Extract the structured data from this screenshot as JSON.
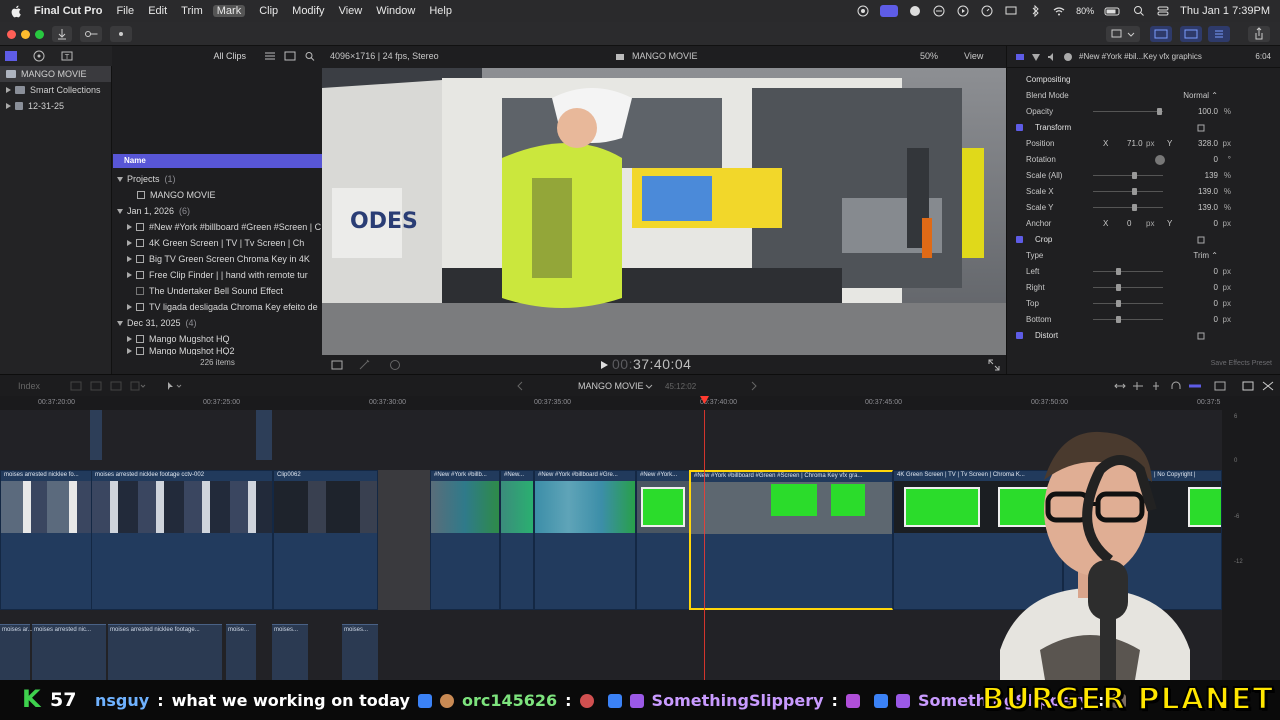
{
  "menubar": {
    "app_name": "Final Cut Pro",
    "menus": [
      "File",
      "Edit",
      "Trim",
      "Mark",
      "Clip",
      "Modify",
      "View",
      "Window",
      "Help"
    ],
    "active_menu": "Mark",
    "battery": "80%",
    "datetime": "Thu Jan 1  7:39PM"
  },
  "browser": {
    "filter_label": "All Clips",
    "libraries": [
      {
        "label": "MANGO MOVIE",
        "selected": true
      },
      {
        "label": "Smart Collections"
      },
      {
        "label": "12-31-25"
      }
    ],
    "column_header": "Name",
    "groups": [
      {
        "label": "Projects",
        "count": "(1)",
        "items": [
          "MANGO MOVIE"
        ]
      },
      {
        "label": "Jan 1, 2026",
        "count": "(6)",
        "items": [
          "#New #York #billboard #Green #Screen | C",
          "4K Green Screen  |  TV  |  Tv Screen  |  Ch",
          "Big TV Green Screen Chroma Key in 4K",
          "Free Clip  Finder  |  |  hand with remote tur",
          "The Undertaker Bell   Sound Effect",
          "TV ligada desligada Chroma Key efeito de"
        ]
      },
      {
        "label": "Dec 31, 2025",
        "count": "(4)",
        "items": [
          "Mango Mugshot HQ",
          "Mango Mugshot HQ2"
        ]
      }
    ],
    "items_count": "226 items"
  },
  "viewer": {
    "format": "4096×1716 | 24 fps, Stereo",
    "project_title": "MANGO MOVIE",
    "zoom": "50%",
    "view_label": "View",
    "timecode_dim": "00:",
    "timecode": "37:40:04"
  },
  "inspector": {
    "clip_title": "#New #York #bil...Key vfx graphics",
    "duration": "6:04",
    "rows": [
      {
        "label": "Compositing",
        "type": "header"
      },
      {
        "label": "Blend Mode",
        "value": "Normal ⌃"
      },
      {
        "label": "Opacity",
        "value": "100.0",
        "unit": "%",
        "slider": 0.98
      },
      {
        "label": "Transform",
        "type": "section"
      },
      {
        "label": "Position",
        "x_label": "X",
        "x": "71.0",
        "x_unit": "px",
        "y_label": "Y",
        "y": "328.0",
        "unit": "px"
      },
      {
        "label": "Rotation",
        "value": "0",
        "unit": "°",
        "dial": true
      },
      {
        "label": "Scale (All)",
        "value": "139",
        "unit": "%",
        "slider": 0.6
      },
      {
        "label": "Scale X",
        "value": "139.0",
        "unit": "%",
        "slider": 0.6
      },
      {
        "label": "Scale Y",
        "value": "139.0",
        "unit": "%",
        "slider": 0.6
      },
      {
        "label": "Anchor",
        "x_label": "X",
        "x": "0",
        "x_unit": "px",
        "y_label": "Y",
        "y": "0",
        "unit": "px"
      },
      {
        "label": "Crop",
        "type": "section"
      },
      {
        "label": "Type",
        "value": "Trim ⌃"
      },
      {
        "label": "Left",
        "value": "0",
        "unit": "px",
        "slider": 0.35
      },
      {
        "label": "Right",
        "value": "0",
        "unit": "px",
        "slider": 0.35
      },
      {
        "label": "Top",
        "value": "0",
        "unit": "px",
        "slider": 0.35
      },
      {
        "label": "Bottom",
        "value": "0",
        "unit": "px",
        "slider": 0.35
      },
      {
        "label": "Distort",
        "type": "section"
      }
    ],
    "save_preset": "Save Effects Preset"
  },
  "timeline": {
    "index_label": "Index",
    "project_title": "MANGO MOVIE",
    "project_duration": "45:12:02",
    "ruler": [
      "00:37:20:00",
      "00:37:25:00",
      "00:37:30:00",
      "00:37:35:00",
      "00:37:40:00",
      "00:37:45:00",
      "00:37:50:00",
      "00:37:5"
    ],
    "clips": [
      "moises arrested nicklee fo...",
      "moises arrested nicklee footage cctv-002",
      "Clip0062",
      "#New #York #billb...",
      "#New...",
      "#New #York #billboard #Gre...",
      "#New #York...",
      "#New #York #billboard #Green #Screen | Chroma Key vfx gra...",
      "4K Green Screen  |  TV  |  Tv Screen  |  Chroma K...",
      "| No Copyright |"
    ],
    "audio_clips": [
      "moises ar...",
      "moises arrested nic...",
      "moises arrested nicklee footage...",
      "moise...",
      "moises...",
      "moises..."
    ],
    "meter_labels": [
      "6",
      "0",
      "-6",
      "-12"
    ]
  },
  "ticker": {
    "channel_letter": "K",
    "channel_count": "57",
    "messages": [
      {
        "user": "nsguy",
        "text": "what we working on today"
      },
      {
        "user": "orc145626",
        "text": ""
      },
      {
        "user": "SomethingSlippery",
        "text": ""
      },
      {
        "user": "SomethingSlippery",
        "text": ""
      }
    ],
    "brand": "BURGER PLANET"
  },
  "colors": {
    "accent": "#5e5ce6",
    "clip_blue": "#213a5c",
    "green_screen": "#2bdc2b",
    "playhead": "#ff3b30",
    "brand_yellow": "#ffe600",
    "chat_user": "#6fb2ff"
  }
}
